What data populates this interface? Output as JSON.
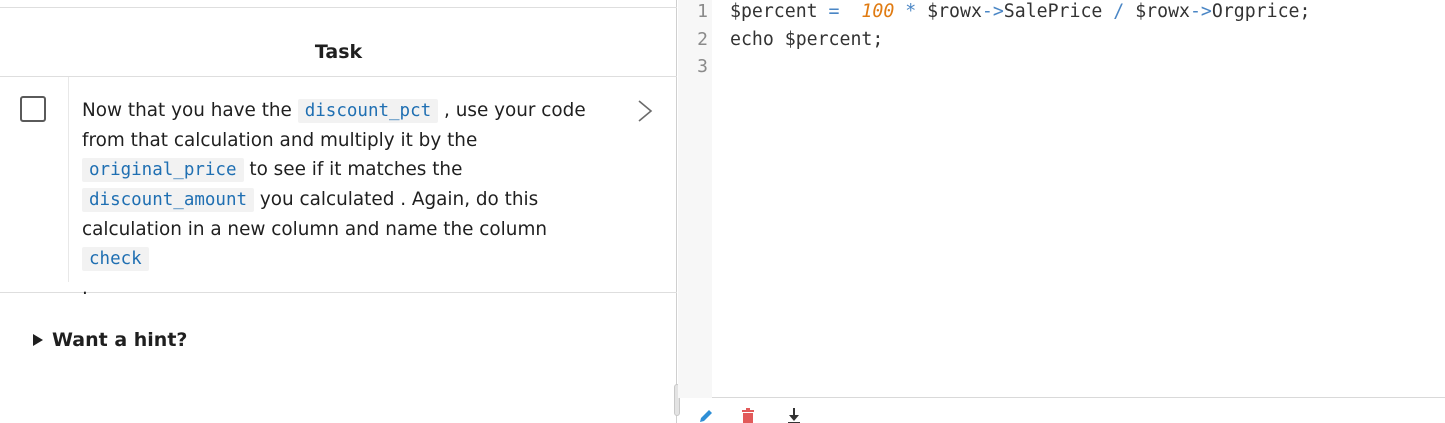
{
  "task_panel": {
    "title": "Task",
    "task": {
      "text_1": "Now that you have the ",
      "code_1": "discount_pct",
      "text_2": " , use your code from that calculation and multiply it by the ",
      "code_2": "original_price",
      "text_3": " to see if it matches the ",
      "code_3": "discount_amount",
      "text_4": " you calculated . Again, do this calculation in a new column and name the column ",
      "code_4": "check",
      "text_5": " ."
    },
    "hint_label": "Want a hint?"
  },
  "editor": {
    "line_numbers": [
      "1",
      "2",
      "3"
    ],
    "line1": {
      "var": "$percent",
      "eq": " = ",
      "num": "100",
      "op1": " * ",
      "obj1": "$rowx",
      "arrow1": "->",
      "prop1": "SalePrice",
      "op2": " / ",
      "obj2": "$rowx",
      "arrow2": "->",
      "prop2": "Orgprice;"
    },
    "line2": "echo $percent;"
  },
  "toolbar": {
    "icons": [
      "pencil-icon",
      "trash-icon",
      "download-icon"
    ],
    "colors": {
      "pencil": "#2f8fd6",
      "trash": "#e25a5a",
      "download": "#333333"
    }
  }
}
